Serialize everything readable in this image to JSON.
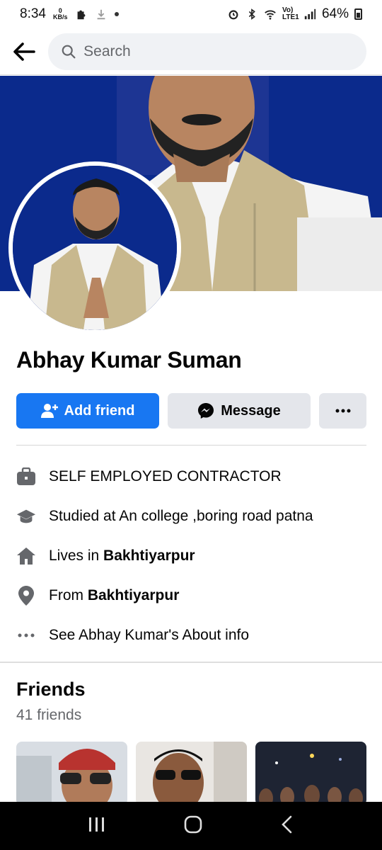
{
  "status": {
    "time": "8:34",
    "kbs_value": "0",
    "kbs_unit": "KB/s",
    "network": "Vo) LTE1",
    "battery": "64%"
  },
  "search": {
    "placeholder": "Search"
  },
  "profile": {
    "name": "Abhay Kumar Suman"
  },
  "actions": {
    "add_friend": "Add friend",
    "message": "Message"
  },
  "about": {
    "work": "SELF EMPLOYED CONTRACTOR",
    "education": "Studied at An college ,boring road patna",
    "lives_prefix": "Lives in ",
    "lives_place": "Bakhtiyarpur",
    "from_prefix": "From ",
    "from_place": "Bakhtiyarpur",
    "see_about": "See Abhay Kumar's About info"
  },
  "friends": {
    "title": "Friends",
    "count": "41 friends"
  },
  "colors": {
    "accent": "#1877f2",
    "cover_bg": "#0b2a8c",
    "secondary_btn": "#e4e6eb",
    "muted_text": "#65676b"
  },
  "icons": {
    "back": "arrow-left-icon",
    "search": "search-icon",
    "add_friend": "person-plus-icon",
    "message": "messenger-icon",
    "more": "more-dots-icon",
    "work": "briefcase-icon",
    "education": "graduation-cap-icon",
    "lives": "home-icon",
    "from": "location-pin-icon",
    "about": "more-dots-icon"
  }
}
